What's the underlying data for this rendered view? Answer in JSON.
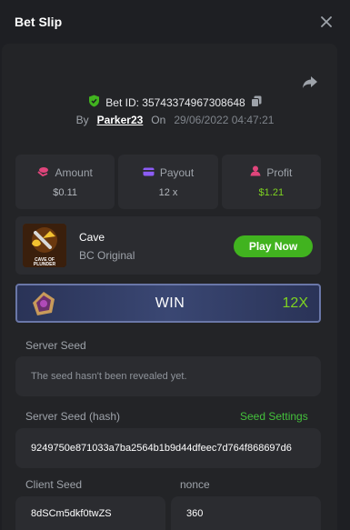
{
  "modal": {
    "title": "Bet Slip",
    "close_icon": "close-icon"
  },
  "bet": {
    "id_label": "Bet ID: 3574337496730864​8",
    "by_label": "By",
    "username": "Parker23",
    "on_label": "On",
    "date": "29/06/2022 04:47:21"
  },
  "stats": [
    {
      "label": "Amount",
      "value": "$0.11",
      "icon": "coins-icon",
      "icon_color": "#e0457b"
    },
    {
      "label": "Payout",
      "value": "12 x",
      "icon": "card-icon",
      "icon_color": "#8c5cf6"
    },
    {
      "label": "Profit",
      "value": "$1.21",
      "icon": "profit-icon",
      "icon_color": "#e0457b"
    }
  ],
  "game": {
    "name": "Cave",
    "provider": "BC Original",
    "thumbnail_text": "CAVE OF PLUNDER",
    "play_label": "Play Now"
  },
  "result": {
    "label": "WIN",
    "multiplier": "12X"
  },
  "seeds": {
    "server_seed_label": "Server Seed",
    "server_seed_value": "The seed hasn't been revealed yet.",
    "server_hash_label": "Server Seed (hash)",
    "seed_settings_label": "Seed Settings",
    "server_hash_value": "9249750e871033a7ba2564b1b9d44dfeec7d764f868697d6",
    "client_seed_label": "Client Seed",
    "client_seed_value": "8dSCm5dkf0twZS",
    "nonce_label": "nonce",
    "nonce_value": "360"
  },
  "colors": {
    "accent_green": "#41b31f",
    "profit_green": "#7ed321",
    "link_green": "#44c13c"
  }
}
